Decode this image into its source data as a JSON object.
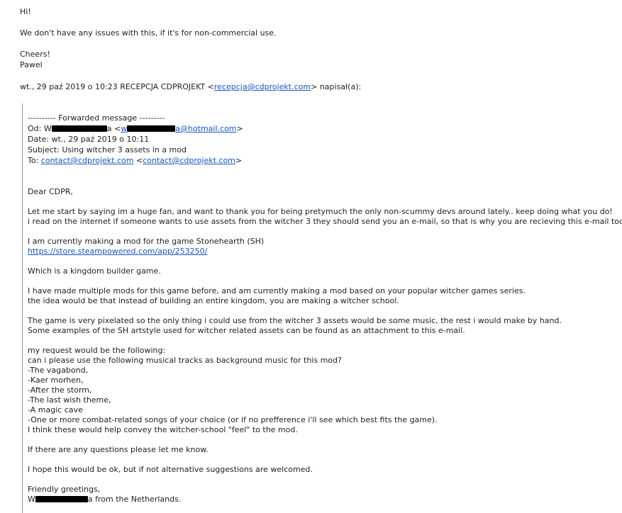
{
  "reply": {
    "greeting": "Hi!",
    "body": "We don't have any issues with this, if it's for non-commercial use.",
    "signoff": "Cheers!",
    "signature": "Pawel",
    "attribution_prefix": "wt., 29 paź 2019 o 10:23 RECEPCJA CDPROJEKT <",
    "attribution_email": "recepcja@cdprojekt.com",
    "attribution_suffix": "> napisał(a):"
  },
  "forwarded": {
    "header": "---------- Forwarded message ---------",
    "from_label": "Od: ",
    "from_name_start": "W",
    "from_name_end": "a <",
    "from_email_start": "w",
    "from_email_mid": "a@hotmail.com",
    "from_close": ">",
    "date": "Date: wt., 29 paź 2019 o 10:11",
    "subject": "Subject: Using witcher 3 assets in a mod",
    "to_label": "To: ",
    "to_email": "contact@cdprojekt.com",
    "to_mid": " <",
    "to_email2": "contact@cdprojekt.com",
    "to_close": ">"
  },
  "message": {
    "salutation": "Dear CDPR,",
    "p1_l1": "Let me start by saying im a huge fan, and want to thank you for being pretymuch the only non-scummy devs around lately.. keep doing what you do!",
    "p1_l2": "i read on the internet if someone wants to use assets from the witcher 3 they should send you an e-mail, so that is why you are recieving this e-mail today.",
    "p2_l1": "I am currently making a mod for the game Stonehearth (SH)",
    "p2_link": "https://store.steampowered.com/app/253250/",
    "p3": "Which is a kingdom builder game.",
    "p4_l1": "I have made multiple mods for this game before, and am currently making a mod based on your popular witcher games series.",
    "p4_l2": "the idea would be that instead of building an entire kingdom, you are making a witcher school.",
    "p5_l1": "The game is very pixelated so the only thing i could use from the witcher 3 assets would be some music, the rest i would make by hand.",
    "p5_l2": "Some examples of the SH artstyle used for witcher related assets can be found as an attachment to this e-mail.",
    "p6_l1": "my request would be the following:",
    "p6_l2": "can i please use the following musical tracks as background music for this mod?",
    "tracks": [
      "-The vagabond,",
      "-Kaer morhen,",
      "-After the storm,",
      "-The last wish theme,",
      "-A magic cave",
      "-One or more combat-related songs of your choice (or if no prefference i'll see which best fits the game)."
    ],
    "p6_end": "I think these would help convey the witcher-school \"feel\" to the mod.",
    "p7": "If there are any questions please let me know.",
    "p8": "I hope this would be ok, but if not alternative suggestions are welcomed.",
    "closing": "Friendly greetings,",
    "sig_start": "W",
    "sig_end": "a from the Netherlands."
  }
}
